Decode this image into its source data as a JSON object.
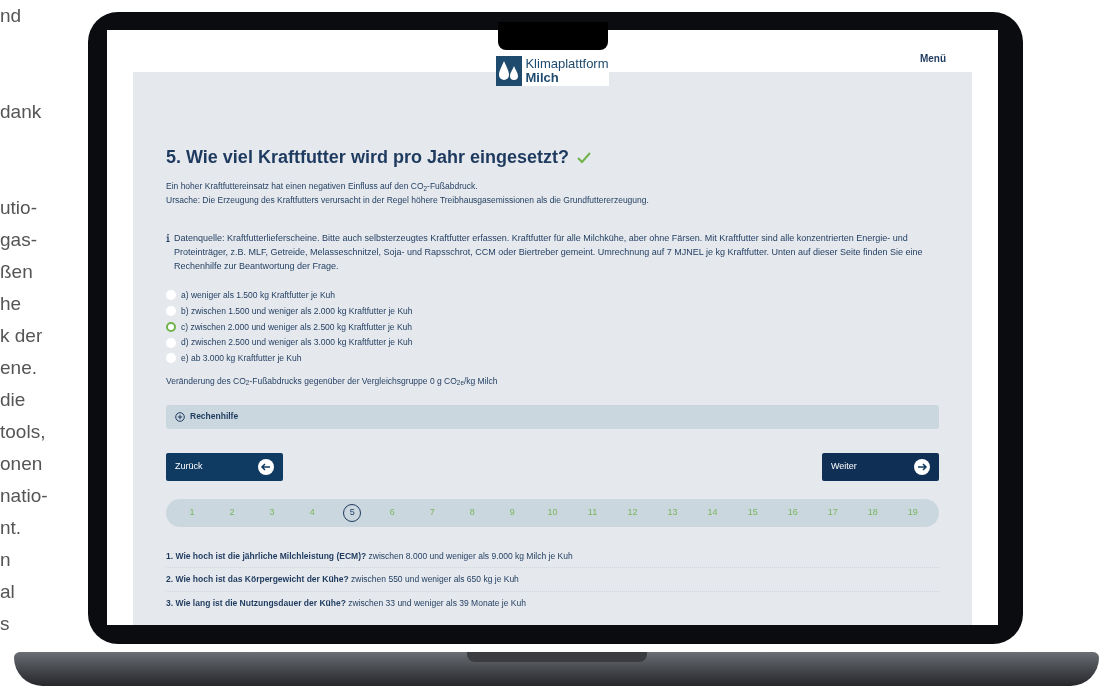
{
  "background_text": {
    "paragraphs": [
      [
        "nd"
      ],
      [
        "dank"
      ],
      [
        "utio-",
        "gas-",
        "ßen",
        "he",
        "k der",
        "ene.",
        "die",
        "tools,",
        "onen",
        "natio-",
        "nt.",
        "n",
        "al",
        "s"
      ]
    ]
  },
  "header": {
    "logo_line_1": "Klimaplattform",
    "logo_line_2": "Milch",
    "menu": "Menü"
  },
  "question": {
    "title": "5. Wie viel Kraftfutter wird pro Jahr eingesetzt?",
    "answered": true,
    "description": [
      "Ein hoher Kraftfuttereinsatz hat einen negativen Einfluss auf den CO$_{2}$-Fußabdruck.",
      "Ursache: Die Erzeugung des Kraftfutters verursacht in der Regel höhere Treibhausgasemissionen als die Grundfuttererzeugung."
    ],
    "info": "Datenquelle: Kraftfutterlieferscheine. Bitte auch selbsterzeugtes Kraftfutter erfassen. Kraftfutter für alle Milchkühe, aber ohne Färsen. Mit Kraftfutter sind alle konzentrierten Energie- und Proteinträger, z.B. MLF, Getreide, Melasseschnitzel, Soja- und Rapsschrot, CCM oder Biertreber gemeint. Umrechnung auf 7 MJNEL je kg Kraftfutter. Unten auf dieser Seite finden Sie eine Rechenhilfe zur Beantwortung der Frage.",
    "options": [
      {
        "label": "a) weniger als 1.500 kg Kraftfutter je Kuh",
        "selected": false
      },
      {
        "label": "b) zwischen 1.500 und weniger als 2.000 kg Kraftfutter je Kuh",
        "selected": false
      },
      {
        "label": "c) zwischen 2.000 und weniger als 2.500 kg Kraftfutter je Kuh",
        "selected": true
      },
      {
        "label": "d) zwischen 2.500 und weniger als 3.000 kg Kraftfutter je Kuh",
        "selected": false
      },
      {
        "label": "e) ab 3.000 kg Kraftfutter je Kuh",
        "selected": false
      }
    ],
    "change": "Veränderung des CO$_{2}$-Fußabdrucks gegenüber der Vergleichsgruppe 0 g CO$_{2e}$/kg Milch"
  },
  "calculator": {
    "label": "Rechenhilfe",
    "expanded": false
  },
  "navigation": {
    "back": "Zurück",
    "next": "Weiter"
  },
  "steps": [
    {
      "label": "1",
      "selected": false,
      "answered": true
    },
    {
      "label": "2",
      "selected": false,
      "answered": true
    },
    {
      "label": "3",
      "selected": false,
      "answered": true
    },
    {
      "label": "4",
      "selected": false,
      "answered": true
    },
    {
      "label": "5",
      "selected": true
    },
    {
      "label": "6",
      "selected": false,
      "answered": true
    },
    {
      "label": "7",
      "selected": false,
      "answered": true
    },
    {
      "label": "8",
      "selected": false,
      "answered": true
    },
    {
      "label": "9",
      "selected": false,
      "answered": true
    },
    {
      "label": "10",
      "selected": false,
      "answered": true
    },
    {
      "label": "11",
      "selected": false,
      "answered": true
    },
    {
      "label": "12",
      "selected": false,
      "answered": true
    },
    {
      "label": "13",
      "selected": false,
      "answered": true
    },
    {
      "label": "14",
      "selected": false,
      "answered": true
    },
    {
      "label": "15",
      "selected": false,
      "answered": true
    },
    {
      "label": "16",
      "selected": false,
      "answered": true
    },
    {
      "label": "17",
      "selected": false,
      "answered": true
    },
    {
      "label": "18",
      "selected": false,
      "answered": true
    },
    {
      "label": "19",
      "selected": false,
      "answered": true
    }
  ],
  "summary": [
    {
      "question": "1. Wie hoch ist die jährliche Milchleistung (ECM)?",
      "answer": "zwischen 8.000 und weniger als 9.000 kg Milch je Kuh"
    },
    {
      "question": "2. Wie hoch ist das Körpergewicht der Kühe?",
      "answer": "zwischen 550 und weniger als 650 kg je Kuh"
    },
    {
      "question": "3. Wie lang ist die Nutzungsdauer der Kühe?",
      "answer": "zwischen 33 und weniger als 39 Monate je Kuh"
    }
  ]
}
